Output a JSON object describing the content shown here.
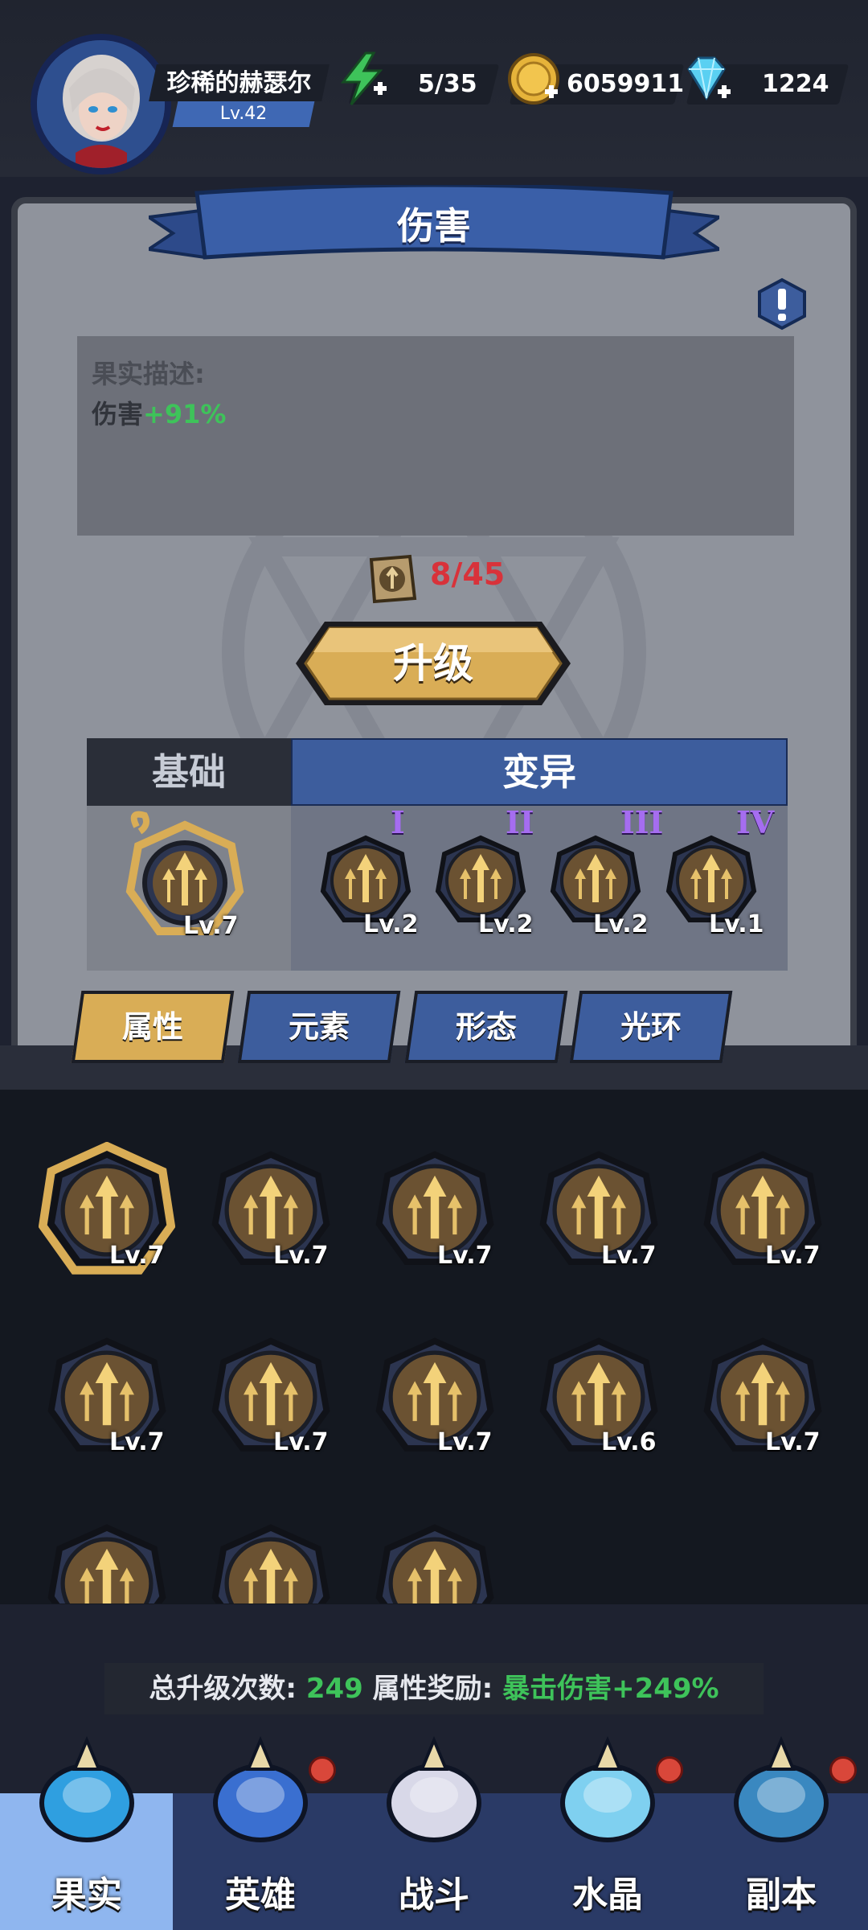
{
  "player": {
    "name": "珍稀的赫瑟尔",
    "level": "Lv.42"
  },
  "resources": {
    "energy": {
      "icon": "lightning-icon",
      "value": "5/35"
    },
    "coins": {
      "icon": "coin-icon",
      "value": "6059911"
    },
    "gems": {
      "icon": "diamond-icon",
      "value": "1224"
    }
  },
  "panel": {
    "title": "伤害",
    "description_label": "果实描述:",
    "description_text": "伤害",
    "description_value": "+91%",
    "cost": "8/45",
    "upgrade_label": "升级",
    "tabs": {
      "base": "基础",
      "mutation": "变异"
    },
    "base_skill": {
      "icon": "arrows-up-icon",
      "level": "Lv.7"
    },
    "mutations": [
      {
        "roman": "I",
        "level": "Lv.2"
      },
      {
        "roman": "II",
        "level": "Lv.2"
      },
      {
        "roman": "III",
        "level": "Lv.2"
      },
      {
        "roman": "IV",
        "level": "Lv.1"
      }
    ]
  },
  "category_tabs": [
    "属性",
    "元素",
    "形态",
    "光环"
  ],
  "fruits": [
    {
      "icon": "arrows-up-icon",
      "level": "Lv.7"
    },
    {
      "icon": "swirl-rune-icon",
      "level": "Lv.7"
    },
    {
      "icon": "four-arrows-icon",
      "level": "Lv.7"
    },
    {
      "icon": "spiral-icon",
      "level": "Lv.7"
    },
    {
      "icon": "chevrons-right-icon",
      "level": "Lv.7"
    },
    {
      "icon": "impact-icon",
      "level": "Lv.7"
    },
    {
      "icon": "broken-heart-icon",
      "level": "Lv.7"
    },
    {
      "icon": "heart-plus-icon",
      "level": "Lv.7"
    },
    {
      "icon": "dash-up-icon",
      "level": "Lv.6"
    },
    {
      "icon": "beam-icon",
      "level": "Lv.7"
    },
    {
      "icon": "burst-icon",
      "level": ""
    },
    {
      "icon": "crack-icon",
      "level": ""
    },
    {
      "icon": "lightning-shard-icon",
      "level": ""
    }
  ],
  "summary": {
    "label1": "总升级次数:",
    "value1": "249",
    "label2": "属性奖励:",
    "value2": "暴击伤害+249%"
  },
  "nav": [
    {
      "label": "果实",
      "icon": "fruit-icon",
      "active": true,
      "badge": false
    },
    {
      "label": "英雄",
      "icon": "wizard-hat-icon",
      "active": false,
      "badge": true
    },
    {
      "label": "战斗",
      "icon": "sword-book-icon",
      "active": false,
      "badge": false
    },
    {
      "label": "水晶",
      "icon": "crystal-icon",
      "active": false,
      "badge": true
    },
    {
      "label": "副本",
      "icon": "portal-icon",
      "active": false,
      "badge": true
    }
  ],
  "colors": {
    "accent_green": "#3ec35a",
    "cost_red": "#d8323a",
    "gold": "#d9ad56",
    "blue": "#3d5d9d"
  }
}
